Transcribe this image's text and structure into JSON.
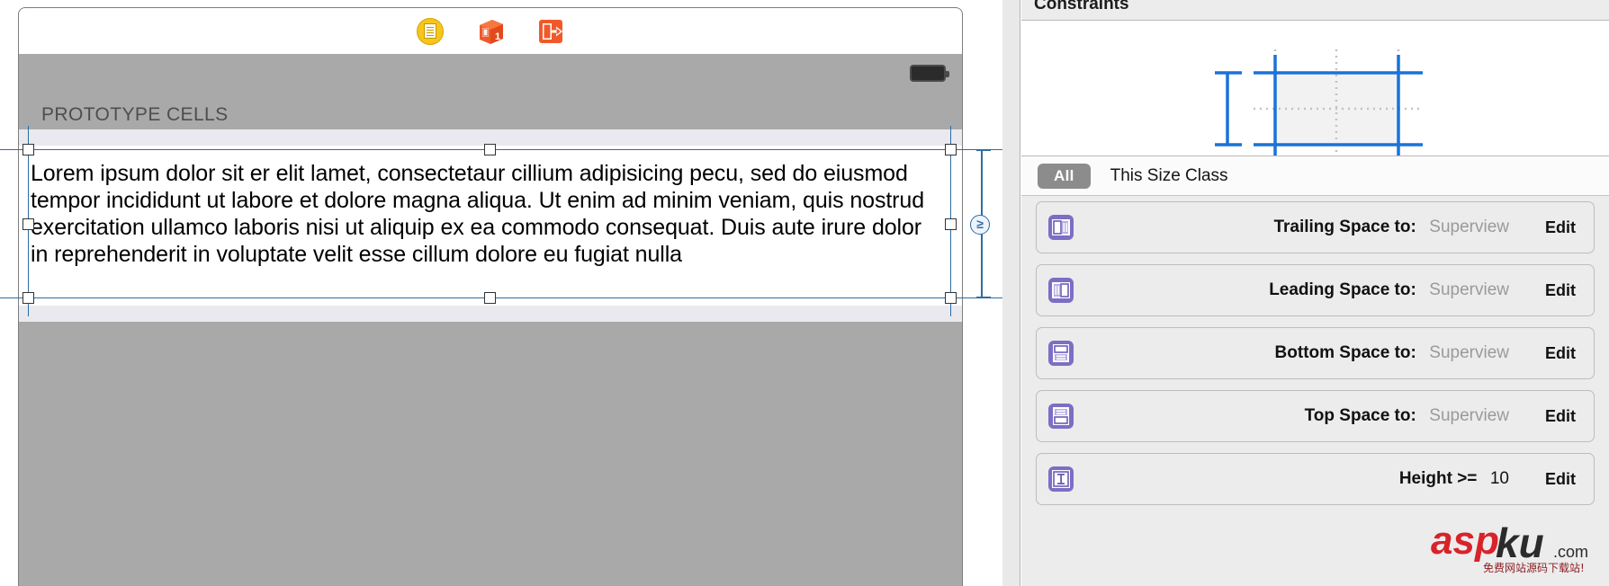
{
  "canvas": {
    "scene_dock": {
      "icons": [
        {
          "name": "view-controller-icon",
          "title": "View Controller"
        },
        {
          "name": "first-responder-cube-icon",
          "title": "First Responder",
          "badge": "1"
        },
        {
          "name": "exit-segue-icon",
          "title": "Exit"
        }
      ]
    },
    "device": {
      "battery_icon": "battery-icon"
    },
    "table_section_header": "PROTOTYPE CELLS",
    "selected_label_text": "Lorem ipsum dolor sit er elit lamet, consectetaur cillium adipisicing pecu, sed do eiusmod tempor incididunt ut labore et dolore magna aliqua. Ut enim ad minim veniam, quis nostrud exercitation ullamco laboris nisi ut aliquip ex ea commodo consequat. Duis aute irure dolor in reprehenderit in voluptate velit esse cillum dolore eu fugiat nulla",
    "constraint_badge": "≥",
    "selection_color": "#2d6da3"
  },
  "inspector": {
    "title": "Constraints",
    "diagram": {
      "name": "constraint-diagram",
      "line_color": "#1a72d8",
      "guide_color": "#bdbdbd",
      "fill_color": "#f2f2f2"
    },
    "size_class": {
      "pill_label": "All",
      "text": "This Size Class",
      "pill_color": "#8c8c8c"
    },
    "constraints": [
      {
        "icon": "trailing-space-constraint-icon",
        "label": "Trailing Space to:",
        "value": "Superview",
        "value_muted": true,
        "edit_label": "Edit"
      },
      {
        "icon": "leading-space-constraint-icon",
        "label": "Leading Space to:",
        "value": "Superview",
        "value_muted": true,
        "edit_label": "Edit"
      },
      {
        "icon": "bottom-space-constraint-icon",
        "label": "Bottom Space to:",
        "value": "Superview",
        "value_muted": true,
        "edit_label": "Edit"
      },
      {
        "icon": "top-space-constraint-icon",
        "label": "Top Space to:",
        "value": "Superview",
        "value_muted": true,
        "edit_label": "Edit"
      },
      {
        "icon": "height-constraint-icon",
        "label": "Height >=",
        "value": "10",
        "value_muted": false,
        "edit_label": "Edit"
      }
    ],
    "icon_accent": "#7b6fc4"
  },
  "watermark": {
    "primary": "asp",
    "secondary": "ku",
    "suffix": ".com",
    "tagline": "免费网站源码下载站!",
    "primary_color": "#d8232a",
    "secondary_color": "#2b2b2b"
  }
}
